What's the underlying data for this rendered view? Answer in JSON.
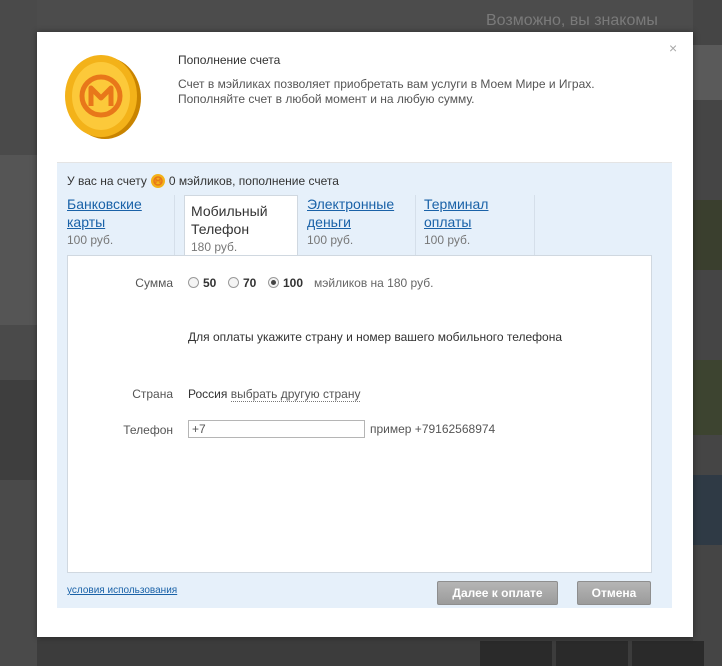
{
  "modal": {
    "title": "Пополнение счета",
    "description_line1": "Счет в мэйликах позволяет приобретать вам услуги в Моем Мире и Играх.",
    "description_line2": "Пополняйте счет в любой момент и на любую сумму.",
    "close_glyph": "×",
    "coin_icon": "mailik-coin-icon",
    "background_title": "Возможно, вы знакомы"
  },
  "balance": {
    "prefix": "У вас на счету",
    "suffix": "0 мэйликов, пополнение счета"
  },
  "tabs": [
    {
      "line1": "Банковские",
      "line2": "карты",
      "price": "100 руб.",
      "active": false
    },
    {
      "line1": "Мобильный",
      "line2": "Телефон",
      "price": "180 руб.",
      "active": true
    },
    {
      "line1": "Электронные",
      "line2": "деньги",
      "price": "100 руб.",
      "active": false
    },
    {
      "line1": "Терминал",
      "line2": "оплаты",
      "price": "100 руб.",
      "active": false
    }
  ],
  "form": {
    "amount_label": "Сумма",
    "amount_options": [
      "50",
      "70",
      "100"
    ],
    "amount_selected": "100",
    "amount_suffix": "мэйликов на 180 руб.",
    "instruction": "Для оплаты укажите страну и номер вашего мобильного телефона",
    "country_label": "Страна",
    "country_value": "Россия",
    "country_change_link": "выбрать другую страну",
    "phone_label": "Телефон",
    "phone_value": "+7",
    "phone_example": "пример +79162568974"
  },
  "footer": {
    "terms_link": "условия использования",
    "next_button": "Далее к оплате",
    "cancel_button": "Отмена"
  },
  "colors": {
    "link": "#1a62a8",
    "panel_bg": "#e6f0fa",
    "coin_gold": "#f0a500",
    "coin_m": "#e8771a"
  }
}
